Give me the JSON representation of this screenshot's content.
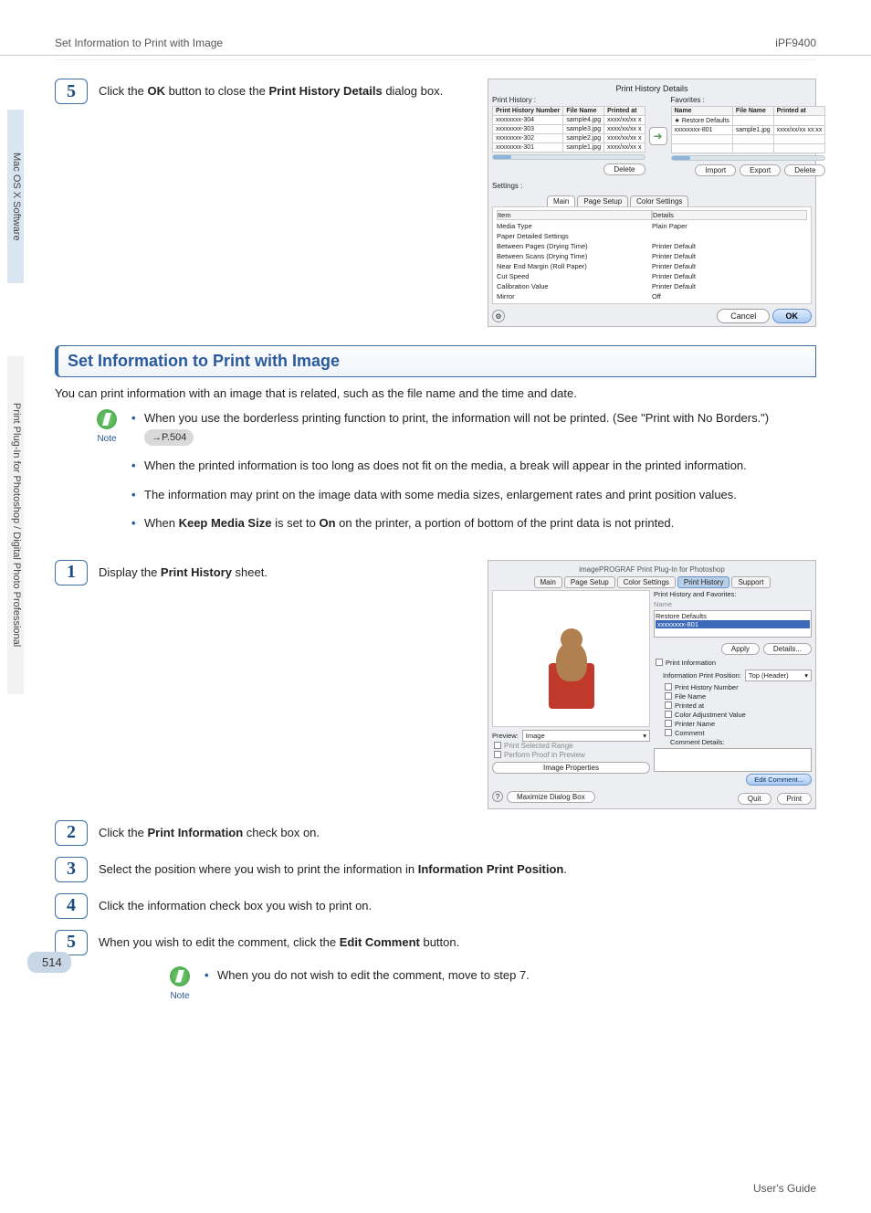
{
  "header": {
    "left": "Set Information to Print with Image",
    "right": "iPF9400"
  },
  "sidetabs": {
    "one": "Mac OS X Software",
    "two": "Print Plug-In for Photoshop / Digital Photo Professional"
  },
  "step5a": {
    "pre": "Click the ",
    "ok": "OK",
    "mid": " button to close the ",
    "bold2": "Print History Details",
    "post": " dialog box."
  },
  "dlg1": {
    "title": "Print History Details",
    "left_label": "Print History :",
    "right_label": "Favorites :",
    "cols_left": {
      "c1": "Print History Number",
      "c2": "File Name",
      "c3": "Printed at"
    },
    "cols_right": {
      "c1": "Name",
      "c2": "File Name",
      "c3": "Printed at"
    },
    "rows_left": [
      {
        "c1": "xxxxxxxx-304",
        "c2": "sample4.jpg",
        "c3": "xxxx/xx/xx x"
      },
      {
        "c1": "xxxxxxxx-303",
        "c2": "sample3.jpg",
        "c3": "xxxx/xx/xx x"
      },
      {
        "c1": "xxxxxxxx-302",
        "c2": "sample2.jpg",
        "c3": "xxxx/xx/xx x"
      },
      {
        "c1": "xxxxxxxx-301",
        "c2": "sample1.jpg",
        "c3": "xxxx/xx/xx x"
      }
    ],
    "rows_right": [
      {
        "c1": "★ Restore Defaults",
        "c2": "",
        "c3": ""
      },
      {
        "c1": "xxxxxxxx-801",
        "c2": "sample1.jpg",
        "c3": "xxxx/xx/xx xx:xx"
      }
    ],
    "delete": "Delete",
    "import": "Import",
    "export": "Export",
    "settings_label": "Settings :",
    "tabs": {
      "main": "Main",
      "page": "Page Setup",
      "color": "Color Settings"
    },
    "settings_head": {
      "item": "Item",
      "details": "Details"
    },
    "settings": [
      {
        "k": "Media Type",
        "v": "Plain Paper"
      },
      {
        "k": "Paper Detailed Settings",
        "v": ""
      },
      {
        "k": "  Between Pages (Drying Time)",
        "v": "Printer Default"
      },
      {
        "k": "  Between Scans (Drying Time)",
        "v": "Printer Default"
      },
      {
        "k": "  Near End Margin (Roll Paper)",
        "v": "Printer Default"
      },
      {
        "k": "  Cut Speed",
        "v": "Printer Default"
      },
      {
        "k": "  Calibration Value",
        "v": "Printer Default"
      },
      {
        "k": "  Mirror",
        "v": "Off"
      }
    ],
    "cancel": "Cancel",
    "okbtn": "OK"
  },
  "section": {
    "title": "Set Information to Print with Image",
    "intro": "You can print information with an image that is related, such as the file name and the time and date."
  },
  "note1": {
    "label": "Note",
    "b1a": "When you use the borderless printing function to print, the information will not be printed.  (See \"Print with No Borders.\")",
    "pill": "→P.504",
    "b2": "When the printed information is too long as does not fit on the media, a break will appear in the printed information.",
    "b3": "The information may print on the image data with some media sizes, enlargement rates and print position values.",
    "b4a": "When ",
    "b4b": "Keep Media Size",
    "b4c": " is set to ",
    "b4d": "On",
    "b4e": " on the printer, a portion of bottom of the print data is not printed."
  },
  "step1": {
    "pre": "Display the ",
    "bold": "Print History",
    "post": " sheet."
  },
  "dlg2": {
    "title": "imagePROGRAF Print Plug-In for Photoshop",
    "tabs": {
      "main": "Main",
      "page": "Page Setup",
      "color": "Color Settings",
      "hist": "Print History",
      "support": "Support"
    },
    "hist_label": "Print History and Favorites:",
    "name_label": "Name",
    "restore": "Restore Defaults",
    "sel": "xxxxxxxx-801",
    "apply": "Apply",
    "details": "Details...",
    "print_info": "Print Information",
    "info_pos_label": "Information Print Position:",
    "info_pos_value": "Top (Header)",
    "c1": "Print History Number",
    "c2": "File Name",
    "c3": "Printed at",
    "c4": "Color Adjustment Value",
    "c5": "Printer Name",
    "c6": "Comment",
    "comment_details": "Comment Details:",
    "edit_comment": "Edit Comment...",
    "preview_label": "Preview:",
    "preview_value": "Image",
    "psr": "Print Selected Range",
    "ppp": "Perform Proof in Preview",
    "img_props": "Image Properties",
    "maximize": "Maximize Dialog Box",
    "quit": "Quit",
    "print": "Print"
  },
  "step2": {
    "pre": "Click the ",
    "bold": "Print Information",
    "post": " check box on."
  },
  "step3": {
    "pre": "Select the position where you wish to print the information in ",
    "bold": "Information Print Position",
    "post": "."
  },
  "step4": {
    "txt": "Click the information check box you wish to print on."
  },
  "step5b": {
    "pre": "When you wish to edit the comment, click the ",
    "bold": "Edit Comment",
    "post": " button."
  },
  "note2": {
    "label": "Note",
    "b1": "When you do not wish to edit the comment, move to step 7."
  },
  "pagenum": "514",
  "footer": "User's Guide"
}
